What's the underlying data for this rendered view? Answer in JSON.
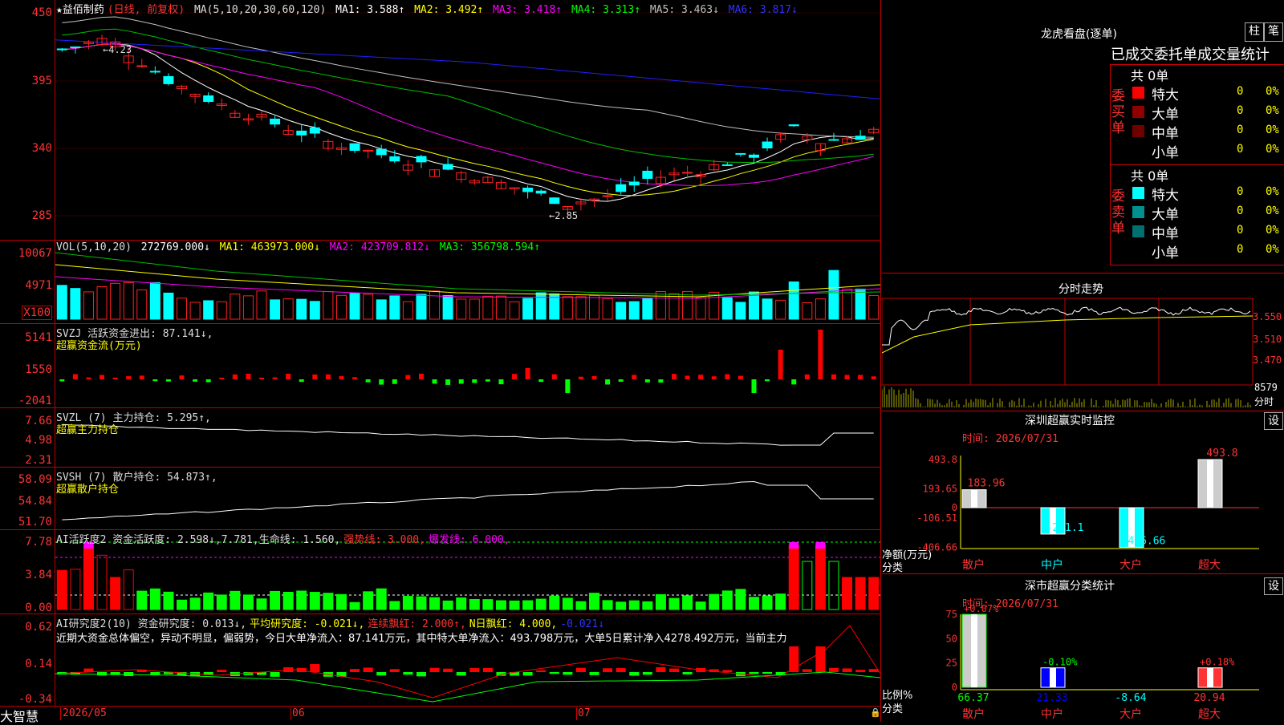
{
  "colors": {
    "up": "#ff2020",
    "down": "#00ffff",
    "ma1": "#ffffff",
    "ma2": "#ffff00",
    "ma3": "#ff00ff",
    "ma4": "#00c000",
    "ma5": "#c0c0c0",
    "ma6": "#2020ff",
    "grid": "#c00000",
    "bull": "#ff0000",
    "bear": "#00ff00"
  },
  "price": {
    "ticks": [
      "450",
      "395",
      "340",
      "285"
    ],
    "title": "★益佰制药",
    "mode": "(日线, 前复权)",
    "ma_list": "MA(5,10,20,30,60,120)",
    "ma1": "MA1: 3.588↑",
    "ma2": "MA2: 3.492↑",
    "ma3": "MA3: 3.418↑",
    "ma4": "MA4: 3.313↑",
    "ma5": "MA5: 3.463↓",
    "ma6": "MA6: 3.817↓",
    "hi_label": "4.23",
    "lo_label": "←2.85"
  },
  "vol": {
    "ticks": [
      "10067",
      "4971"
    ],
    "unit": "X100",
    "title": "VOL(5,10,20)",
    "v": "272769.000↓",
    "ma1": "MA1: 463973.000↓",
    "ma2": "MA2: 423709.812↓",
    "ma3": "MA3: 356798.594↑"
  },
  "svzj": {
    "ticks": [
      "5141",
      "1550",
      "-2041"
    ],
    "title": "SVZJ  活跃资金进出: 87.141↓,",
    "sub": "超赢资金流(万元)"
  },
  "svzl": {
    "ticks": [
      "7.66",
      "4.98",
      "2.31"
    ],
    "title": "SVZL (7) 主力持仓: 5.295↑,",
    "sub": "超赢主力持仓"
  },
  "svsh": {
    "ticks": [
      "58.09",
      "54.84",
      "51.70"
    ],
    "title": "SVSH (7) 散户持仓: 54.873↑,",
    "sub": "超赢散户持仓"
  },
  "ai1": {
    "ticks": [
      "7.78",
      "3.84",
      "0.00"
    ],
    "title": "AI活跃度2 资金活跃度: 2.598↓,7.781,生命线: 1.560,",
    "strong": "强势线: 3.000,",
    "burst": "爆发线: 6.000,"
  },
  "ai2": {
    "ticks": [
      "0.62",
      "0.14",
      "-0.34"
    ],
    "title": "AI研究度2(10) 资金研究度: 0.013↓,",
    "avg": "平均研究度: -0.021↓,",
    "lian": "连续飘红: 2.000↑,",
    "nday": "N日飘红: 4.000,",
    "neg": "-0.021↓",
    "summary": "近期大资金总体偏空，异动不明显，偏弱势，今日大单净流入：87.141万元，其中特大单净流入：493.798万元，大单5日累计净入4278.492万元，当前主力"
  },
  "footer": {
    "brand": "大智慧",
    "dates": [
      "2026/05",
      "06",
      "07"
    ]
  },
  "right": {
    "lhb_title": "龙虎看盘(逐单)",
    "btn_zhu": "柱",
    "btn_bi": "笔",
    "stat_title": "已成交委托单成交量统计",
    "buy_label": "委买单",
    "sell_label": "委卖单",
    "buy_total": "共 0单",
    "sell_total": "共 0单",
    "buy_rows": [
      {
        "name": "特大",
        "v": "0",
        "p": "0%",
        "c": "#ff0000"
      },
      {
        "name": "大单",
        "v": "0",
        "p": "0%",
        "c": "#900000"
      },
      {
        "name": "中单",
        "v": "0",
        "p": "0%",
        "c": "#700000"
      },
      {
        "name": "小单",
        "v": "0",
        "p": "0%",
        "c": "#000000"
      }
    ],
    "sell_rows": [
      {
        "name": "特大",
        "v": "0",
        "p": "0%",
        "c": "#00ffff"
      },
      {
        "name": "大单",
        "v": "0",
        "p": "0%",
        "c": "#009090"
      },
      {
        "name": "中单",
        "v": "0",
        "p": "0%",
        "c": "#007070"
      },
      {
        "name": "小单",
        "v": "0",
        "p": "0%",
        "c": "#000000"
      }
    ],
    "fs_title": "分时走势",
    "fs_ticks": [
      "3.550",
      "3.510",
      "3.470"
    ],
    "fs_vol": "8579",
    "fs_unit": "分时",
    "sz_title": "深圳超赢实时监控",
    "sz_set": "设",
    "sz_time": "时间: 2026/07/31",
    "sz_ticks": [
      "493.8",
      "193.65",
      "0",
      "-106.51",
      "-406.66"
    ],
    "sz_ylab": "净额(万元)",
    "sz_xlab": "分类",
    "sc_title": "深市超赢分类统计",
    "sc_set": "设",
    "sc_time": "时间: 2026/07/31",
    "sc_ticks": [
      "75",
      "50",
      "25",
      "0"
    ],
    "sc_ylab": "比例%",
    "sc_xlab": "分类"
  },
  "chart_data": [
    {
      "type": "bar",
      "title": "深圳超赢实时监控",
      "xlabel": "分类",
      "ylabel": "净额(万元)",
      "categories": [
        "散户",
        "中户",
        "大户",
        "超大"
      ],
      "values": [
        183.96,
        -271.1,
        -406.66,
        493.8
      ],
      "ylim": [
        -406.66,
        493.8
      ]
    },
    {
      "type": "bar",
      "title": "深市超赢分类统计",
      "xlabel": "分类",
      "ylabel": "比例%",
      "categories": [
        "散户",
        "中户",
        "大户",
        "超大"
      ],
      "values": [
        66.37,
        21.33,
        -8.64,
        20.94
      ],
      "changes": [
        "+0.07%",
        "-0.10%",
        "",
        "+0.18%"
      ],
      "ylim": [
        0,
        75
      ]
    }
  ]
}
